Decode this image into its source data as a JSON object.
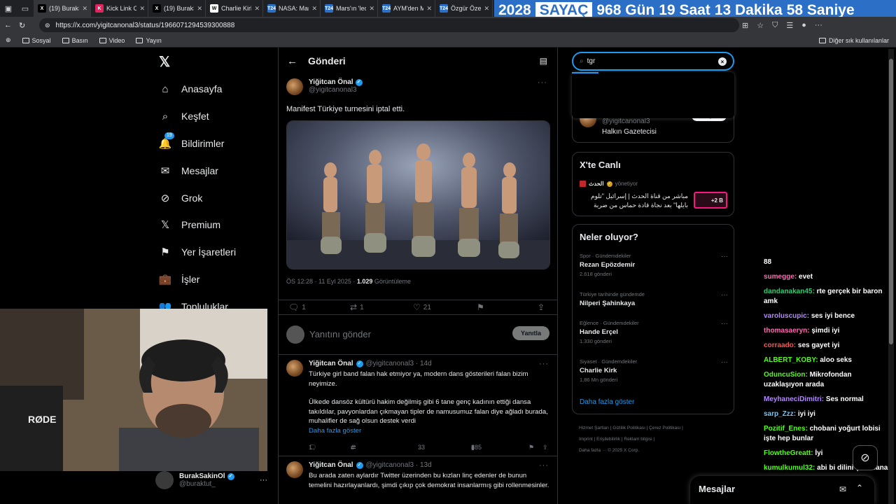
{
  "browser": {
    "tabs": [
      {
        "title": "(19) BurakS",
        "favicon": "X",
        "color": "#000000"
      },
      {
        "title": "Kick Link Cr",
        "favicon": "K",
        "color": "#e0245e"
      },
      {
        "title": "(19) BurakS",
        "favicon": "X",
        "color": "#000000"
      },
      {
        "title": "Charlie Kirk",
        "favicon": "W",
        "color": "#ffffff"
      },
      {
        "title": "NASA: Mars",
        "favicon": "T24",
        "color": "#2b6fc7"
      },
      {
        "title": "Mars'ın 'leo",
        "favicon": "T24",
        "color": "#2b6fc7"
      },
      {
        "title": "AYM'den M",
        "favicon": "T24",
        "color": "#2b6fc7"
      },
      {
        "title": "Özgür Özel",
        "favicon": "T24",
        "color": "#2b6fc7"
      }
    ],
    "url": "https://x.com/yigitcanonal3/status/1966071294539300888",
    "bookmarks": [
      "Sosyal",
      "Basın",
      "Video",
      "Yayın"
    ],
    "bookmarks_other": "Diğer sık kullanılanlar"
  },
  "countdown": {
    "year": "2028",
    "label": "SAYAÇ",
    "days": "968 Gün",
    "hours": "19 Saat",
    "minutes": "13 Dakika",
    "seconds": "58 Saniye"
  },
  "nav": {
    "items": [
      {
        "label": "Anasayfa",
        "icon": "home-icon"
      },
      {
        "label": "Keşfet",
        "icon": "search-icon"
      },
      {
        "label": "Bildirimler",
        "icon": "bell-icon",
        "badge": "19"
      },
      {
        "label": "Mesajlar",
        "icon": "mail-icon"
      },
      {
        "label": "Grok",
        "icon": "grok-icon"
      },
      {
        "label": "Premium",
        "icon": "x-logo-icon"
      },
      {
        "label": "Yer İşaretleri",
        "icon": "bookmark-icon"
      },
      {
        "label": "İşler",
        "icon": "briefcase-icon"
      },
      {
        "label": "Topluluklar",
        "icon": "people-icon"
      }
    ],
    "user": {
      "name": "BurakSakinOl",
      "handle": "@buraktut_"
    }
  },
  "post": {
    "header": "Gönderi",
    "author": {
      "name": "Yiğitcan Önal",
      "handle": "@yigitcanonal3"
    },
    "text": "Manifest Türkiye turnesini iptal etti.",
    "time": "ÖS 12:28 · 11 Eyl 2025 · ",
    "views_count": "1.029",
    "views_label": " Görüntüleme",
    "stats": {
      "replies": "1",
      "reposts": "1",
      "likes": "21"
    },
    "reply_placeholder": "Yanıtını gönder",
    "reply_button": "Yanıtla"
  },
  "replies": [
    {
      "name": "Yiğitcan Önal",
      "handle": "@yigitcanonal3 · 14d",
      "text1": "Türkiye girl band falan hak etmiyor ya, modern dans gösterileri falan bizim neyimize.",
      "text2": "Ülkede dansöz kültürü hakim değilmiş gibi 6 tane genç kadının ettiği dansa takıldılar, pavyonlardan çıkmayan tipler de namusumuz falan diye ağladı burada, muhalifler de sağ olsun destek verdi",
      "more": "Daha fazla göster",
      "replies": "1",
      "reposts": "4",
      "likes": "33",
      "views": "885"
    },
    {
      "name": "Yiğitcan Önal",
      "handle": "@yigitcanonal3 · 13d",
      "text1": "Bu arada zaten aylardır Twitter üzerinden bu kızları linç edenler de bunun temelini hazırlayanlardı, şimdi çıkıp çok demokrat insanlarmış gibi rollenmesinler."
    }
  ],
  "search": {
    "value": "tgr"
  },
  "profile_card": {
    "handle": "@yigitcanonal3",
    "bio": "Halkın Gazetecisi",
    "follow": "Takip et"
  },
  "live": {
    "title": "X'te Canlı",
    "host": "الحدث",
    "host_role": "yönetiyor",
    "text": "مباشر من قناة الحدث | إسرائيل \"تلوم بايلها\" بعد نجاة قادة حماس من ضربة",
    "listeners": "+2 B"
  },
  "trends": {
    "title": "Neler oluyor?",
    "items": [
      {
        "category": "Spor · Gündemdekiler",
        "name": "Rezan Epözdemir",
        "count": "2.618 gönderi"
      },
      {
        "category": "Türkiye tarihinde gündemde",
        "name": "Nilperi Şahinkaya",
        "count": ""
      },
      {
        "category": "Eğlence · Gündemdekiler",
        "name": "Hande Erçel",
        "count": "1.330 gönderi"
      },
      {
        "category": "Siyaset · Gündemdekiler",
        "name": "Charlie Kirk",
        "count": "1,86 Mn gönderi"
      }
    ],
    "show_more": "Daha fazla göster"
  },
  "footer": {
    "line1": "Hizmet Şartları  |  Gizlilik Politikası  |  Çerez Politikası  |",
    "line2": "Imprint  |  Erişilebilirlik  |  Reklam bilgisi  |",
    "line3": "Daha fazla ···  © 2025 X Corp."
  },
  "messages_drawer": {
    "label": "Mesajlar"
  },
  "chat": [
    {
      "user": "",
      "msg": "88",
      "color": "#ffffff"
    },
    {
      "user": "sumegge:",
      "msg": "evet",
      "color": "#ff69b4"
    },
    {
      "user": "dandanakan45:",
      "msg": "rte gerçek bir baron amk",
      "color": "#2ecc71"
    },
    {
      "user": "varoluscupic:",
      "msg": "ses iyi bence",
      "color": "#b388ff"
    },
    {
      "user": "thomasaeryn:",
      "msg": "şimdi iyi",
      "color": "#ff69b4"
    },
    {
      "user": "corraado:",
      "msg": "ses gayet iyi",
      "color": "#ff5252"
    },
    {
      "user": "ALBERT_KOBY:",
      "msg": "aloo seks",
      "color": "#53fc18"
    },
    {
      "user": "OduncuSion:",
      "msg": "Mikrofondan uzaklaşıyon arada",
      "color": "#53fc18"
    },
    {
      "user": "MeyhaneciDimitri:",
      "msg": "Ses normal",
      "color": "#b388ff"
    },
    {
      "user": "sarp_Zzz:",
      "msg": "iyi iyi",
      "color": "#6ec6ff"
    },
    {
      "user": "Pozitif_Enes:",
      "msg": "chobani yoğurt lobisi işte hep bunlar",
      "color": "#53fc18"
    },
    {
      "user": "FlowtheGreatt:",
      "msg": "İyi",
      "color": "#53fc18"
    },
    {
      "user": "kumulkumul32:",
      "msg": "abi bi dilini çıkarsana",
      "color": "#53fc18"
    }
  ]
}
